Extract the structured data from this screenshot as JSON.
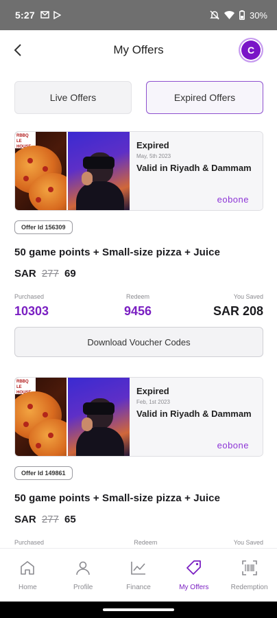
{
  "status_bar": {
    "time": "5:27",
    "battery": "30%"
  },
  "header": {
    "title": "My Offers",
    "avatar_initial": "C"
  },
  "tabs": [
    {
      "label": "Live Offers"
    },
    {
      "label": "Expired Offers"
    }
  ],
  "offers": [
    {
      "status": "Expired",
      "date": "May, 5th 2023",
      "validity": "Valid in Riyadh & Dammam",
      "brand": "eobone",
      "restaurant_logo": "RBBQ LE HOUSE",
      "offer_id": "Offer Id 156309",
      "title": "50 game points + Small-size pizza + Juice",
      "currency": "SAR",
      "old_price": "277",
      "new_price": "69",
      "stats": [
        {
          "label": "Purchased",
          "value": "10303"
        },
        {
          "label": "Redeem",
          "value": "9456"
        },
        {
          "label": "You Saved",
          "value": "SAR 208"
        }
      ],
      "download_label": "Download Voucher Codes"
    },
    {
      "status": "Expired",
      "date": "Feb, 1st 2023",
      "validity": "Valid in Riyadh & Dammam",
      "brand": "eobone",
      "restaurant_logo": "RBBQ LE HOUSE",
      "offer_id": "Offer Id 149861",
      "title": "50 game points + Small-size pizza + Juice",
      "currency": "SAR",
      "old_price": "277",
      "new_price": "65",
      "stats": [
        {
          "label": "Purchased",
          "value": ""
        },
        {
          "label": "Redeem",
          "value": ""
        },
        {
          "label": "You Saved",
          "value": ""
        }
      ]
    }
  ],
  "bottom_nav": [
    {
      "label": "Home",
      "icon": "home-icon"
    },
    {
      "label": "Profile",
      "icon": "profile-icon"
    },
    {
      "label": "Finance",
      "icon": "finance-chart-icon"
    },
    {
      "label": "My Offers",
      "icon": "tag-icon",
      "active": true
    },
    {
      "label": "Redemption",
      "icon": "barcode-scan-icon"
    }
  ],
  "colors": {
    "accent": "#7a1fc2",
    "status_bar": "#6f6f6f"
  }
}
